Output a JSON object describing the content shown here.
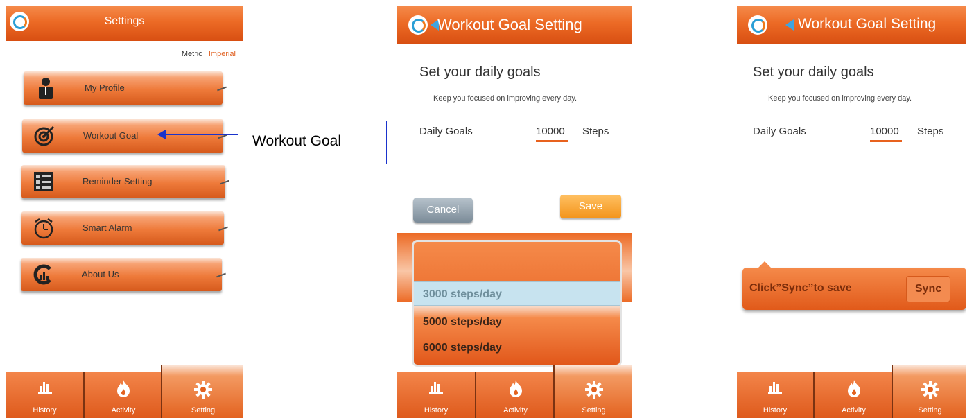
{
  "screen1": {
    "title": "Settings",
    "units": {
      "metric": "Metric",
      "imperial": "Imperial"
    },
    "menu": [
      {
        "label": "My Profile",
        "icon": "person-icon"
      },
      {
        "label": "Workout Goal",
        "icon": "target-icon"
      },
      {
        "label": "Reminder Setting",
        "icon": "checklist-icon"
      },
      {
        "label": "Smart Alarm",
        "icon": "alarm-clock-icon"
      },
      {
        "label": "About Us",
        "icon": "chart-logo-icon"
      }
    ],
    "callout": "Workout Goal"
  },
  "screen2": {
    "title": "Workout Goal Setting",
    "heading": "Set your daily goals",
    "subtitle": "Keep you focused on improving every day.",
    "goal_label": "Daily Goals",
    "goal_value": "10000",
    "goal_unit": "Steps",
    "cancel": "Cancel",
    "save": "Save",
    "picker_options": [
      "3000 steps/day",
      "5000 steps/day",
      "6000 steps/day"
    ]
  },
  "screen3": {
    "title": "Workout Goal Setting",
    "heading": "Set your daily goals",
    "subtitle": "Keep you focused on improving every day.",
    "goal_label": "Daily Goals",
    "goal_value": "10000",
    "goal_unit": "Steps",
    "sync_message": "Click”Sync”to save",
    "sync_button": "Sync"
  },
  "tabs": [
    {
      "label": "History",
      "icon": "bar-chart-icon"
    },
    {
      "label": "Activity",
      "icon": "flame-icon"
    },
    {
      "label": "Setting",
      "icon": "gear-icon"
    }
  ],
  "colors": {
    "accent": "#ec6a25",
    "link": "#1a33cc",
    "back_arrow": "#3fa4e0"
  }
}
